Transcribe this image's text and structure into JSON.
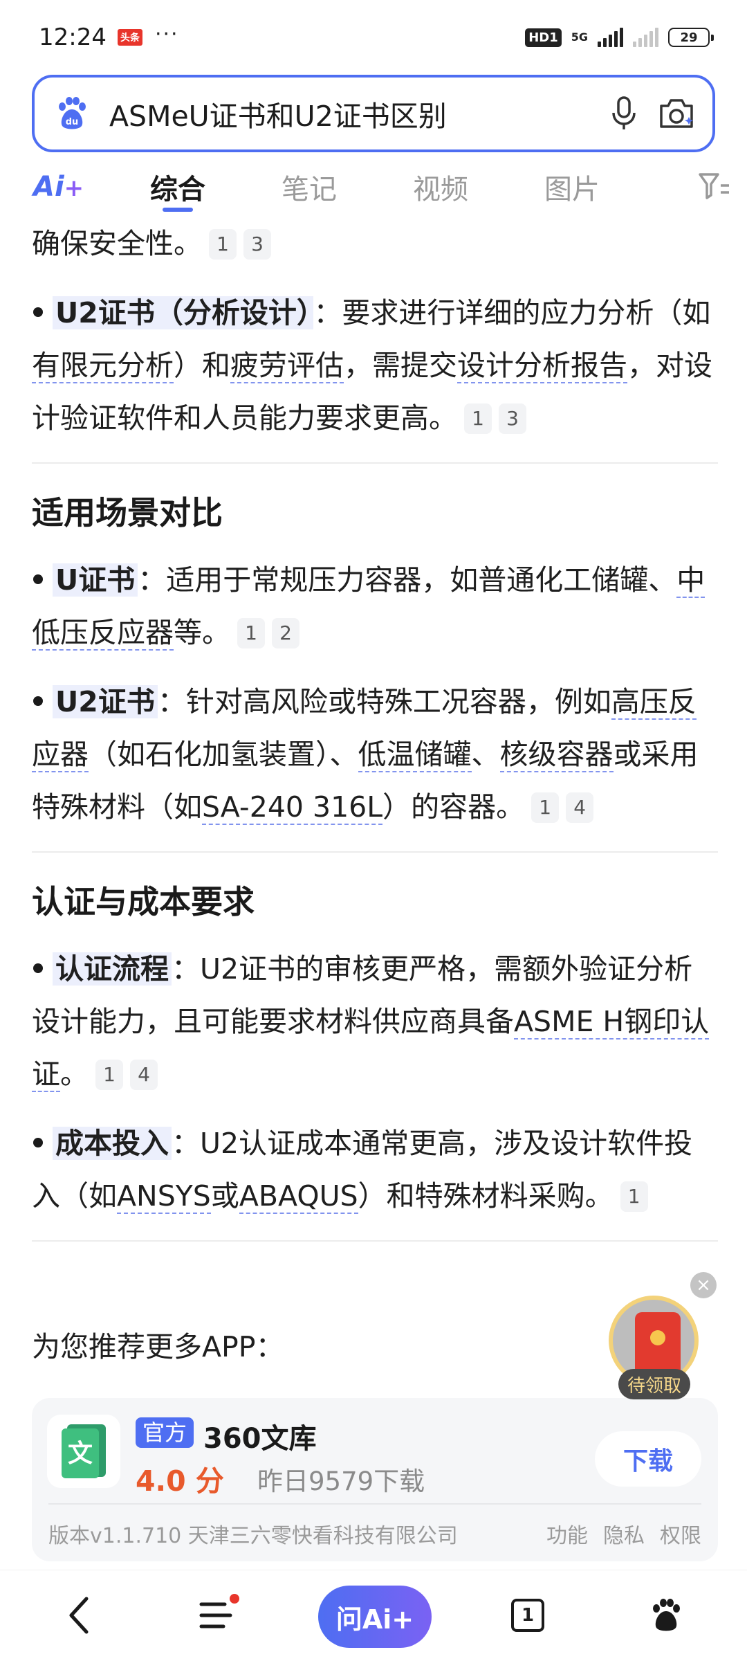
{
  "status_bar": {
    "time": "12:24",
    "news_badge": "头条",
    "more": "···",
    "hd": "HD1",
    "net": "5G",
    "battery": "29"
  },
  "search": {
    "query": "ASMeU证书和U2证书区别"
  },
  "tabs": {
    "ai_logo": "Ai",
    "ai_plus": "+",
    "items": [
      "综合",
      "笔记",
      "视频",
      "图片"
    ]
  },
  "content": {
    "top_line": {
      "text": "确保安全性。",
      "refs": [
        "1",
        "3"
      ]
    },
    "u2_design": {
      "kw": "U2证书（分析设计）",
      "t1": "：要求进行详细的应力分析（如",
      "l1": "有限元分析",
      "t2": "）和",
      "l2": "疲劳评估",
      "t3": "，需提交",
      "l3": "设计分析报告",
      "t4": "，对设计验证软件和人员能力要求更高。",
      "refs": [
        "1",
        "3"
      ]
    },
    "section2": "适用场景对比",
    "u_scene": {
      "kw": "U证书",
      "t1": "：适用于常规压力容器，如普通化工储罐、",
      "l1": "中低压反应器",
      "t2": "等。",
      "refs": [
        "1",
        "2"
      ]
    },
    "u2_scene": {
      "kw": "U2证书",
      "t1": "：针对高风险或特殊工况容器，例如",
      "l1": "高压反应器",
      "t2": "（如石化加氢装置）、",
      "l2": "低温储罐",
      "t3": "、",
      "l3": "核级容器",
      "t4": "或采用特殊材料（如",
      "l4": "SA-240 316L",
      "t5": "）的容器。",
      "refs": [
        "1",
        "4"
      ]
    },
    "section3": "认证与成本要求",
    "cert_flow": {
      "kw": "认证流程",
      "t1": "：U2证书的审核更严格，需额外验证分析设计能力，且可能要求材料供应商具备",
      "l1": "ASME H钢印认证",
      "t2": "。",
      "refs": [
        "1",
        "4"
      ]
    },
    "cost": {
      "kw": "成本投入",
      "t1": "：U2认证成本通常更高，涉及设计软件投入（如",
      "l1": "ANSYS",
      "t2": "或",
      "l2": "ABAQUS",
      "t3": "）和特殊材料采购。",
      "refs": [
        "1"
      ]
    }
  },
  "recommend": {
    "title": "为您推荐更多APP：",
    "badge": "官方",
    "app_name": "360文库",
    "score": "4.0 分",
    "downloads": "昨日9579下载",
    "download_btn": "下载",
    "meta": "版本v1.1.710  天津三六零快看科技有限公司",
    "links": [
      "功能",
      "隐私",
      "权限"
    ],
    "icon_char": "文"
  },
  "float": {
    "close": "×",
    "label": "待领取"
  },
  "bottom_nav": {
    "ask_ai": "问Ai+",
    "tab_count": "1"
  }
}
